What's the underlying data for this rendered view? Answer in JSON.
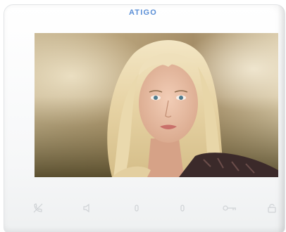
{
  "device": {
    "brand": "ATIGO"
  },
  "buttons": [
    {
      "name": "mute-call-icon"
    },
    {
      "name": "speaker-icon"
    },
    {
      "name": "unlock-1-icon"
    },
    {
      "name": "unlock-2-icon"
    },
    {
      "name": "key-icon"
    },
    {
      "name": "lock-icon"
    }
  ],
  "colors": {
    "brand": "#5b8fd6",
    "panel": "#ffffff",
    "icon": "#cfd2d5"
  }
}
